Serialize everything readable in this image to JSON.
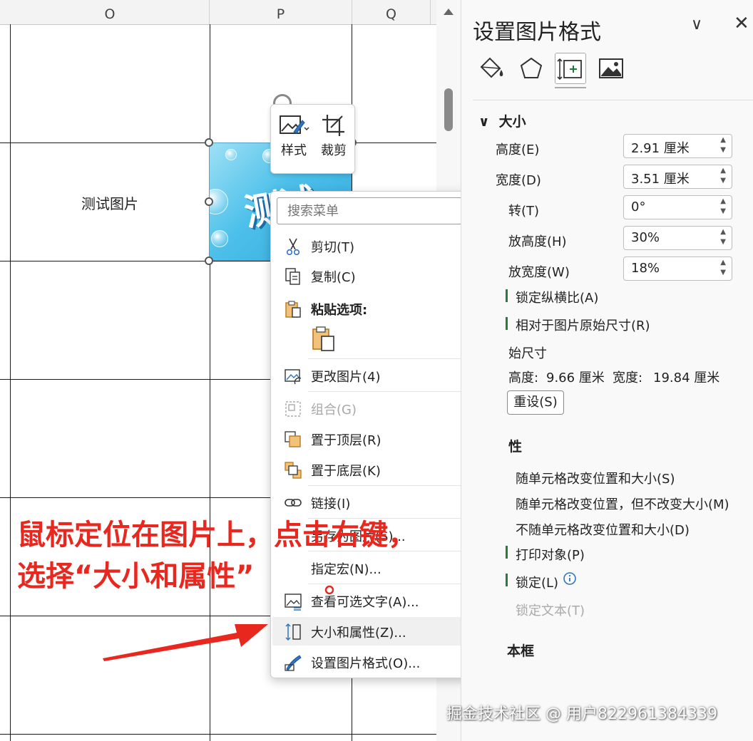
{
  "spreadsheet": {
    "columns": [
      "O",
      "P",
      "Q"
    ],
    "cell_text": "测试图片",
    "picture_text": "测试"
  },
  "mini_toolbar": {
    "style_label": "样式",
    "crop_label": "裁剪"
  },
  "context_menu": {
    "search_placeholder": "搜索菜单",
    "items": [
      {
        "label": "剪切(T)",
        "icon": "scissors-icon",
        "enabled": true,
        "submenu": false
      },
      {
        "label": "复制(C)",
        "icon": "copy-icon",
        "enabled": true,
        "submenu": false
      },
      {
        "label": "粘贴选项:",
        "icon": "paste-icon",
        "enabled": true,
        "submenu": false
      },
      {
        "label": "更改图片(4)",
        "icon": "change-picture-icon",
        "enabled": true,
        "submenu": true
      },
      {
        "label": "组合(G)",
        "icon": "group-icon",
        "enabled": false,
        "submenu": true
      },
      {
        "label": "置于顶层(R)",
        "icon": "bring-front-icon",
        "enabled": true,
        "submenu": true
      },
      {
        "label": "置于底层(K)",
        "icon": "send-back-icon",
        "enabled": true,
        "submenu": true
      },
      {
        "label": "链接(I)",
        "icon": "link-icon",
        "enabled": true,
        "submenu": false
      },
      {
        "label": "另存为图片(S)...",
        "icon": "",
        "enabled": true,
        "submenu": false
      },
      {
        "label": "指定宏(N)...",
        "icon": "",
        "enabled": true,
        "submenu": false
      },
      {
        "label": "查看可选文字(A)...",
        "icon": "alt-text-icon",
        "enabled": true,
        "submenu": false
      },
      {
        "label": "大小和属性(Z)...",
        "icon": "size-properties-icon",
        "enabled": true,
        "submenu": false
      },
      {
        "label": "设置图片格式(O)...",
        "icon": "format-picture-icon",
        "enabled": true,
        "submenu": false
      }
    ]
  },
  "format_pane": {
    "title": "设置图片格式",
    "size_section": "大小",
    "height_label": "高度(E)",
    "height_value": "2.91 厘米",
    "width_label": "宽度(D)",
    "width_value": "3.51 厘米",
    "rotation_label": "转(T)",
    "rotation_value": "0°",
    "scale_height_label": "放高度(H)",
    "scale_height_value": "30%",
    "scale_width_label": "放宽度(W)",
    "scale_width_value": "18%",
    "lock_aspect_label": "锁定纵横比(A)",
    "relative_label": "相对于图片原始尺寸(R)",
    "original_size_label": "始尺寸",
    "original_height_label": "高度:",
    "original_height_value": "9.66 厘米",
    "original_width_label": "宽度:",
    "original_width_value": "19.84 厘米",
    "reset_label": "重设(S)",
    "properties_section": "性",
    "move_and_size_label": "随单元格改变位置和大小(S)",
    "move_no_size_label": "随单元格改变位置，但不改变大小(M)",
    "no_move_label": "不随单元格改变位置和大小(D)",
    "print_label": "打印对象(P)",
    "locked_label": "锁定(L)",
    "lock_text_label": "锁定文本(T)",
    "textbox_section": "本框"
  },
  "annotation": {
    "line1": "鼠标定位在图片上，点击右键，",
    "line2": "选择“大小和属性”",
    "color": "#e8271f"
  },
  "watermark": "掘金技术社区 @ 用户822961384339"
}
